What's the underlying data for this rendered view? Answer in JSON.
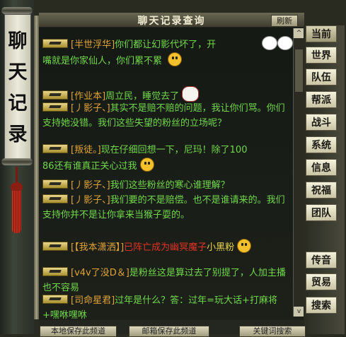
{
  "side_banner": {
    "title": "聊天记录"
  },
  "window": {
    "title": "聊天记录查询",
    "refresh": "刷新",
    "scroll_up": "^",
    "scroll_down": "v"
  },
  "messages": [
    {
      "name": "[半世浮华]",
      "text": "你们都让幻影代坏了，开",
      "cont": "嘴就是你家仙人，你们累不累"
    },
    {
      "name": "[作业本]",
      "text": "周立民，睡觉去了"
    },
    {
      "name": "[丿影子、]",
      "text": "其实不是赔不赔的问题，我让你们骂。你们支持她没错。我们这些失望的粉丝的立场呢？"
    },
    {
      "name": "[叛徒。]",
      "text": "现在仔细回想一下，尼玛！除了100",
      "cont": "86还有谁真正关心过我"
    },
    {
      "name": "[丿影子、]",
      "text": "我们这些粉丝的寒心谁理解？"
    },
    {
      "name": "[丿影子、]",
      "text": "我们要的不是赔偿。也不是谁请来的。我们支持你并不是让你拿来当猴子耍的。"
    },
    {
      "name": "[【我本潇洒】]",
      "text": "已阵亡成为幽冥魔子小黑粉",
      "highlight": "已阵亡成为幽冥魔子",
      "tail": "小黑粉"
    },
    {
      "name": "[v4v了没D＆]",
      "text": "是粉丝这是算过去了别提了，人加主播也不容易"
    },
    {
      "name": "[司命星君]",
      "text": "过年是什么？答：过年=玩大话+打麻将+嘿咻嘿咻"
    }
  ],
  "menu": [
    "当前",
    "世界",
    "队伍",
    "帮派",
    "战斗",
    "系统",
    "信息",
    "祝福",
    "团队",
    "传音",
    "贸易",
    "搜索"
  ],
  "bottom": {
    "btn1": "本地保存此频道",
    "btn2": "邮箱保存此频道",
    "btn3": "关键词搜索"
  },
  "colors": {
    "channel_green": "#71d84a",
    "name_orange": "#e1a335",
    "alert_red": "#e13325"
  }
}
